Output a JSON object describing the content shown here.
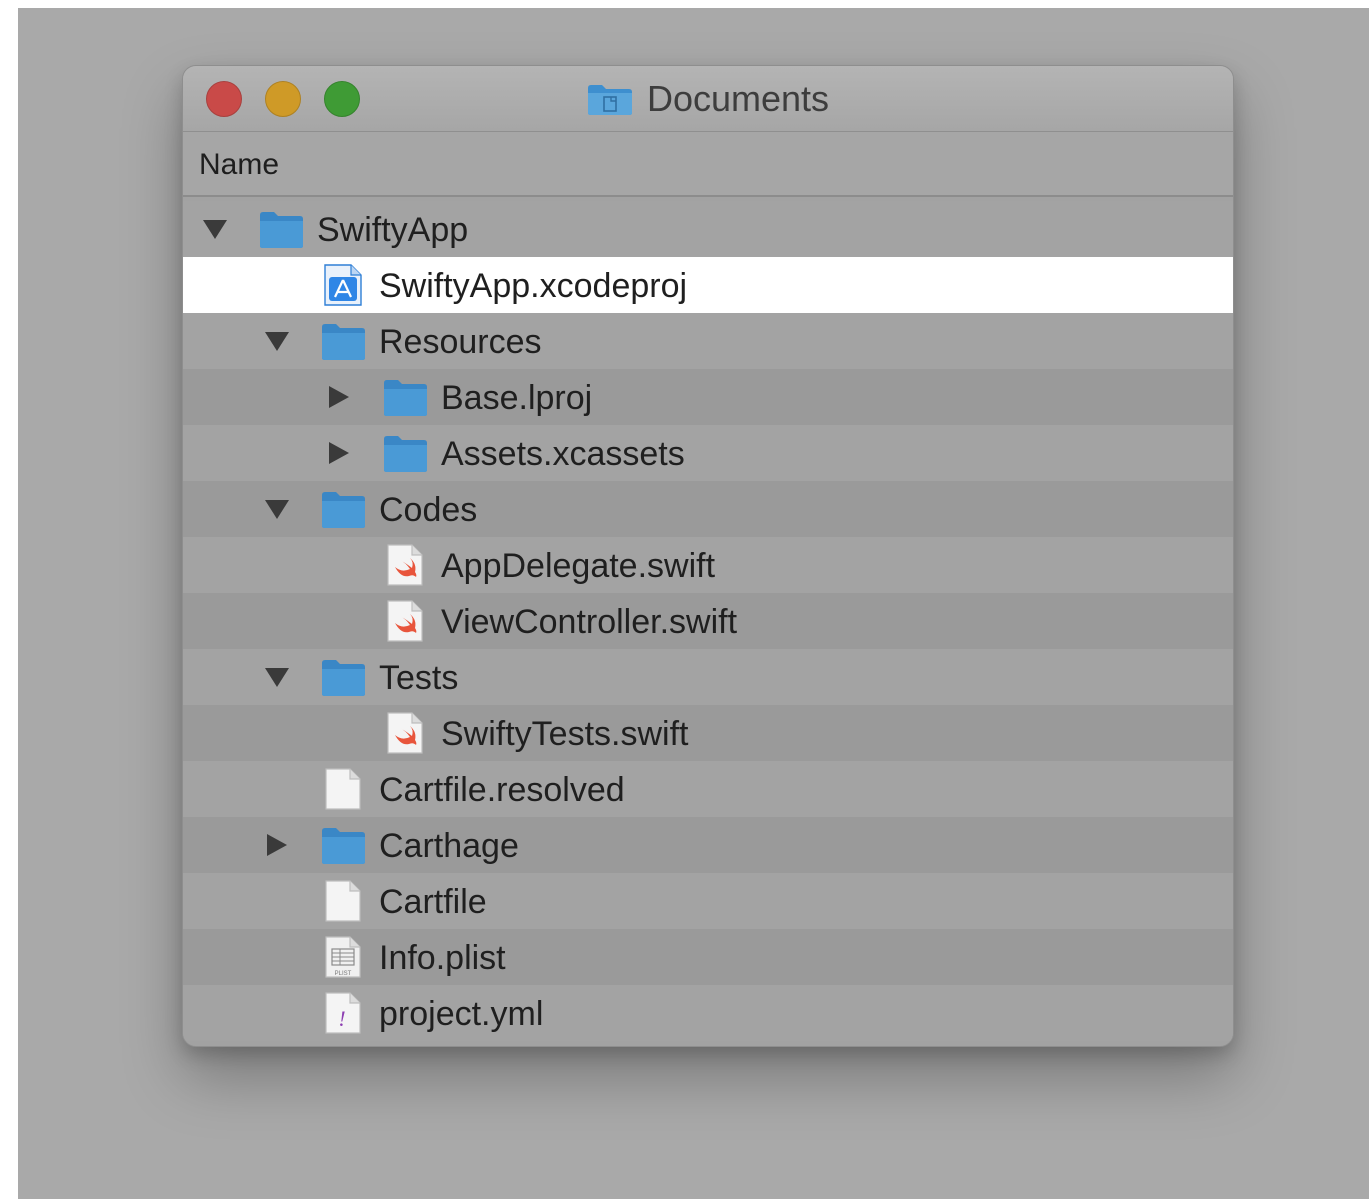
{
  "window": {
    "title": "Documents",
    "title_icon": "folder-icon",
    "traffic_lights": {
      "close": "#c94a48",
      "minimize": "#cf9a27",
      "zoom": "#3f9b35"
    }
  },
  "column_header": {
    "name": "Name"
  },
  "rows": [
    {
      "label": "SwiftyApp",
      "depth": 0,
      "disclosure": "expanded",
      "icon": "folder-icon"
    },
    {
      "label": "SwiftyApp.xcodeproj",
      "depth": 1,
      "disclosure": "none",
      "icon": "xcodeproj-icon",
      "selected": true
    },
    {
      "label": "Resources",
      "depth": 1,
      "disclosure": "expanded",
      "icon": "folder-icon"
    },
    {
      "label": "Base.lproj",
      "depth": 2,
      "disclosure": "collapsed",
      "icon": "folder-icon"
    },
    {
      "label": "Assets.xcassets",
      "depth": 2,
      "disclosure": "collapsed",
      "icon": "folder-icon"
    },
    {
      "label": "Codes",
      "depth": 1,
      "disclosure": "expanded",
      "icon": "folder-icon"
    },
    {
      "label": "AppDelegate.swift",
      "depth": 2,
      "disclosure": "none",
      "icon": "swift-file-icon"
    },
    {
      "label": "ViewController.swift",
      "depth": 2,
      "disclosure": "none",
      "icon": "swift-file-icon"
    },
    {
      "label": "Tests",
      "depth": 1,
      "disclosure": "expanded",
      "icon": "folder-icon"
    },
    {
      "label": "SwiftyTests.swift",
      "depth": 2,
      "disclosure": "none",
      "icon": "swift-file-icon"
    },
    {
      "label": "Cartfile.resolved",
      "depth": 1,
      "disclosure": "none",
      "icon": "blank-file-icon"
    },
    {
      "label": "Carthage",
      "depth": 1,
      "disclosure": "collapsed",
      "icon": "folder-icon"
    },
    {
      "label": "Cartfile",
      "depth": 1,
      "disclosure": "none",
      "icon": "blank-file-icon"
    },
    {
      "label": "Info.plist",
      "depth": 1,
      "disclosure": "none",
      "icon": "plist-file-icon",
      "icon_text": "PLIST"
    },
    {
      "label": "project.yml",
      "depth": 1,
      "disclosure": "none",
      "icon": "yaml-file-icon",
      "icon_text": "!"
    }
  ],
  "colors": {
    "folder": "#3e8fcf",
    "folder_tab": "#5aa6dc",
    "selection": "#ffffff",
    "swift_orange": "#e8553c",
    "yaml_purple": "#8d3fb2"
  }
}
